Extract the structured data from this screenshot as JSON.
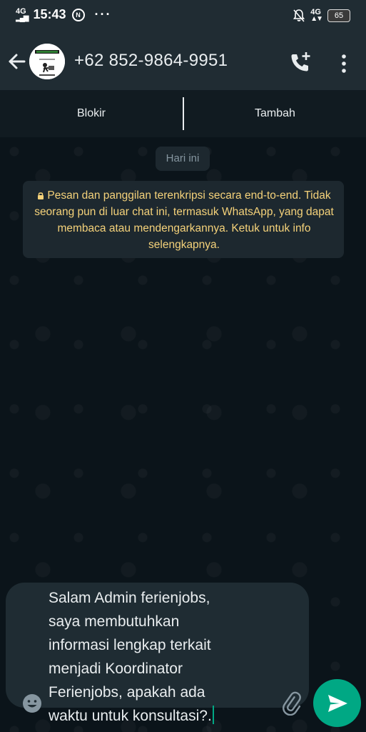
{
  "status_bar": {
    "network_left": "4G",
    "time": "15:43",
    "circle_badge": "N",
    "dots": "···",
    "network_right": "4G",
    "battery": "65"
  },
  "app_bar": {
    "contact_name": "+62 852-9864-9951"
  },
  "actions": {
    "block_label": "Blokir",
    "add_label": "Tambah"
  },
  "chat": {
    "date_chip": "Hari ini",
    "encryption_notice": "Pesan dan panggilan terenkripsi secara end-to-end. Tidak seorang pun di luar chat ini, termasuk WhatsApp, yang dapat membaca atau mendengarkannya. Ketuk untuk info selengkapnya."
  },
  "composer": {
    "message": "Salam Admin ferienjobs,\nsaya membutuhkan\ninformasi lengkap terkait\nmenjadi Koordinator\nFerienjobs, apakah ada\nwaktu untuk konsultasi?."
  },
  "colors": {
    "accent": "#00a884",
    "header_bg": "#202c33",
    "chat_bg": "#0b141a",
    "notice_text": "#f5d27a"
  }
}
